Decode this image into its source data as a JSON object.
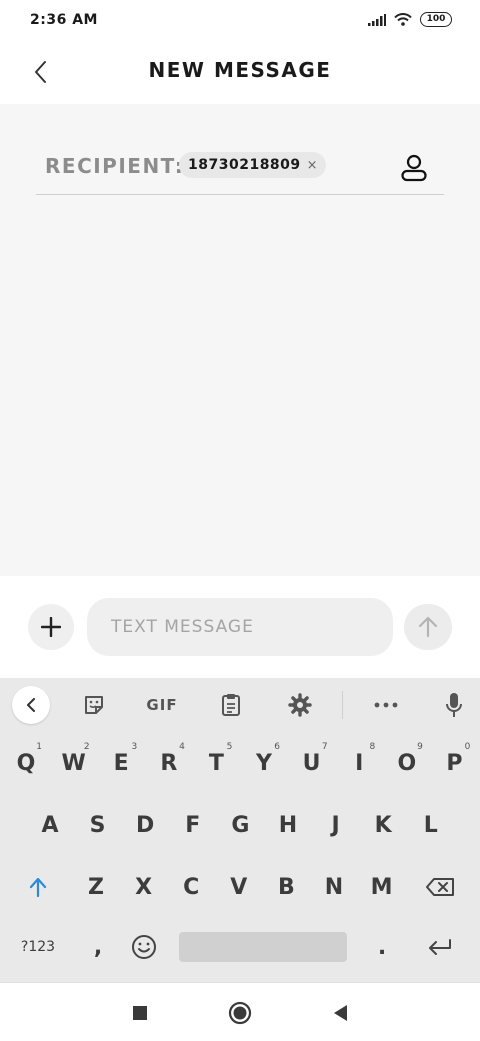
{
  "status_bar": {
    "time": "2:36 AM",
    "battery": "100"
  },
  "header": {
    "title": "NEW MESSAGE"
  },
  "recipient": {
    "label": "RECIPIENT:",
    "chip_number": "18730218809",
    "remove_glyph": "×"
  },
  "composer": {
    "placeholder": "TEXT MESSAGE",
    "value": ""
  },
  "keyboard": {
    "toolbar": {
      "gif_label": "GIF"
    },
    "row1": [
      {
        "label": "Q",
        "hint": "1"
      },
      {
        "label": "W",
        "hint": "2"
      },
      {
        "label": "E",
        "hint": "3"
      },
      {
        "label": "R",
        "hint": "4"
      },
      {
        "label": "T",
        "hint": "5"
      },
      {
        "label": "Y",
        "hint": "6"
      },
      {
        "label": "U",
        "hint": "7"
      },
      {
        "label": "I",
        "hint": "8"
      },
      {
        "label": "O",
        "hint": "9"
      },
      {
        "label": "P",
        "hint": "0"
      }
    ],
    "row2": [
      "A",
      "S",
      "D",
      "F",
      "G",
      "H",
      "J",
      "K",
      "L"
    ],
    "row3": [
      "Z",
      "X",
      "C",
      "V",
      "B",
      "N",
      "M"
    ],
    "symbols_label": "?123",
    "comma": ",",
    "period": "."
  },
  "icons": {
    "back": "chevron-left-icon",
    "contact": "person-icon",
    "attach": "plus-icon",
    "send": "arrow-up-icon",
    "shift": "shift-arrow-icon",
    "backspace": "backspace-icon",
    "emoji": "smiley-icon",
    "enter": "enter-icon",
    "mic": "microphone-icon"
  },
  "colors": {
    "shift_active": "#2b8bd8",
    "content_bg": "#f6f6f6",
    "keyboard_bg": "#e9e9e9"
  }
}
